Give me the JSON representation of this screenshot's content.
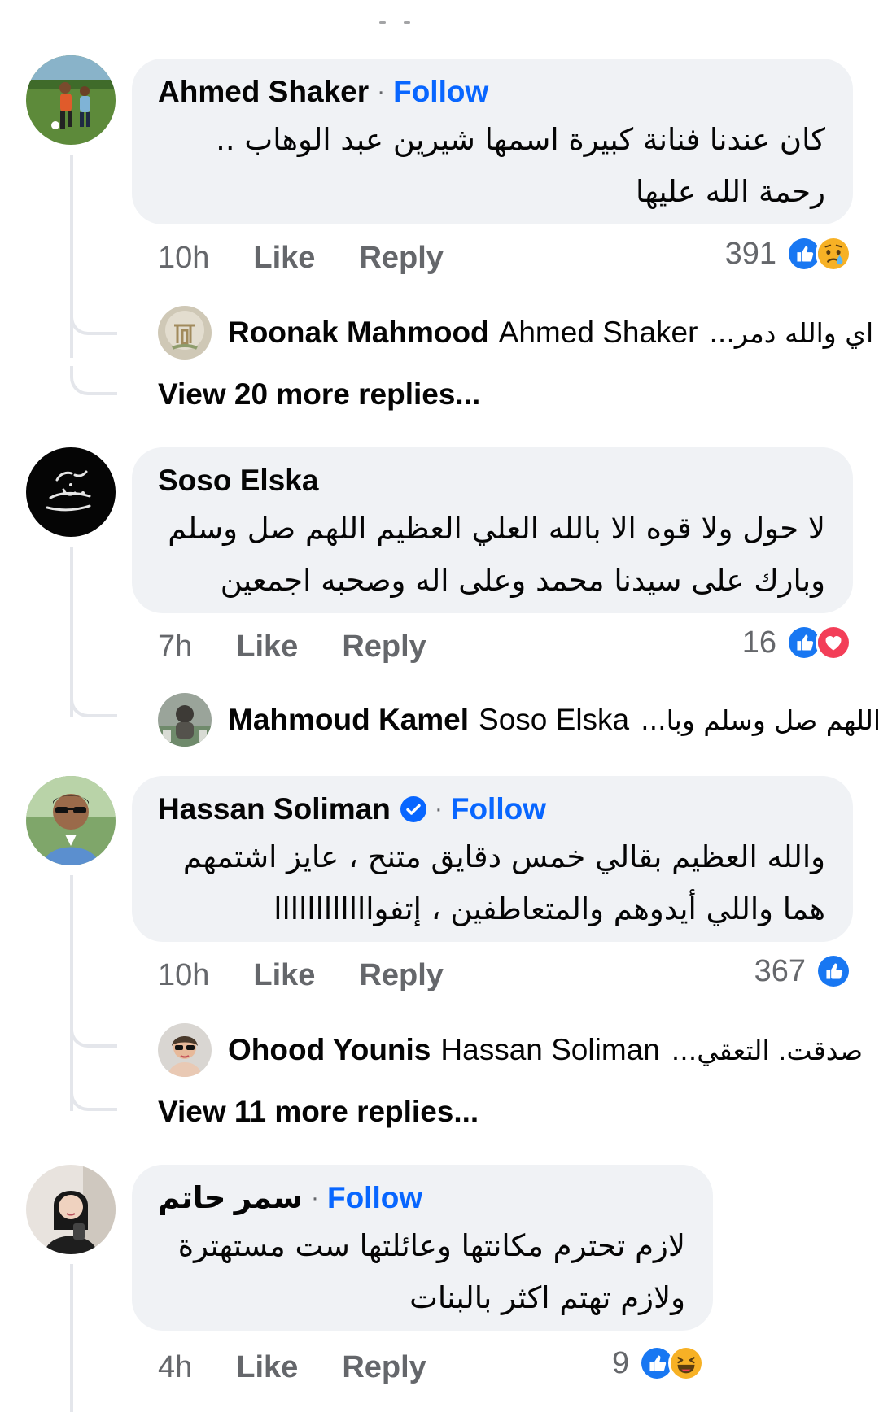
{
  "comments": [
    {
      "author": "Ahmed Shaker",
      "follow_label": "Follow",
      "dot": "·",
      "text_line1": "كان عندنا فنانة كبيرة اسمها شيرين عبد الوهاب ..",
      "text_line2": "رحمة الله عليها",
      "time": "10h",
      "like_label": "Like",
      "reply_label": "Reply",
      "reaction_count": "391",
      "reactions": [
        "like-icon",
        "sad-icon"
      ],
      "reply": {
        "author": "Roonak Mahmood",
        "mention": "Ahmed Shaker",
        "text": "اي والله دمر..."
      },
      "more_replies": "View 20 more replies..."
    },
    {
      "author": "Soso Elska",
      "text_line1": "لا حول ولا قوه الا بالله العلي العظيم اللهم صل وسلم",
      "text_line2": "وبارك على سيدنا محمد وعلى اله وصحبه اجمعين",
      "time": "7h",
      "like_label": "Like",
      "reply_label": "Reply",
      "reaction_count": "16",
      "reactions": [
        "like-icon",
        "love-icon"
      ],
      "reply": {
        "author": "Mahmoud Kamel",
        "mention": "Soso Elska",
        "text": "اللهم صل وسلم وبا..."
      }
    },
    {
      "author": "Hassan Soliman",
      "follow_label": "Follow",
      "dot": "·",
      "verified": true,
      "text_line1": "والله العظيم بقالي خمس دقايق متنح ، عايز اشتمهم",
      "text_line2": "هما واللي أيدوهم والمتعاطفين ، إتفواااااااااااا",
      "time": "10h",
      "like_label": "Like",
      "reply_label": "Reply",
      "reaction_count": "367",
      "reactions": [
        "like-icon"
      ],
      "reply": {
        "author": "Ohood Younis",
        "mention": "Hassan Soliman",
        "text": "صدقت. التعقي..."
      },
      "more_replies": "View 11 more replies..."
    },
    {
      "author": "سمر حاتم",
      "follow_label": "Follow",
      "dot": "·",
      "text_line1": "لازم تحترم مكانتها وعائلتها ست مستهترة",
      "text_line2": "ولازم تهتم اكثر بالبنات",
      "time": "4h",
      "like_label": "Like",
      "reply_label": "Reply",
      "reaction_count": "9",
      "reactions": [
        "like-icon",
        "haha-icon"
      ]
    }
  ],
  "colors": {
    "accent": "#0866ff",
    "bubble": "#f0f2f5",
    "secondary_text": "#65676b",
    "love": "#f33e58",
    "haha": "#f7b125"
  }
}
